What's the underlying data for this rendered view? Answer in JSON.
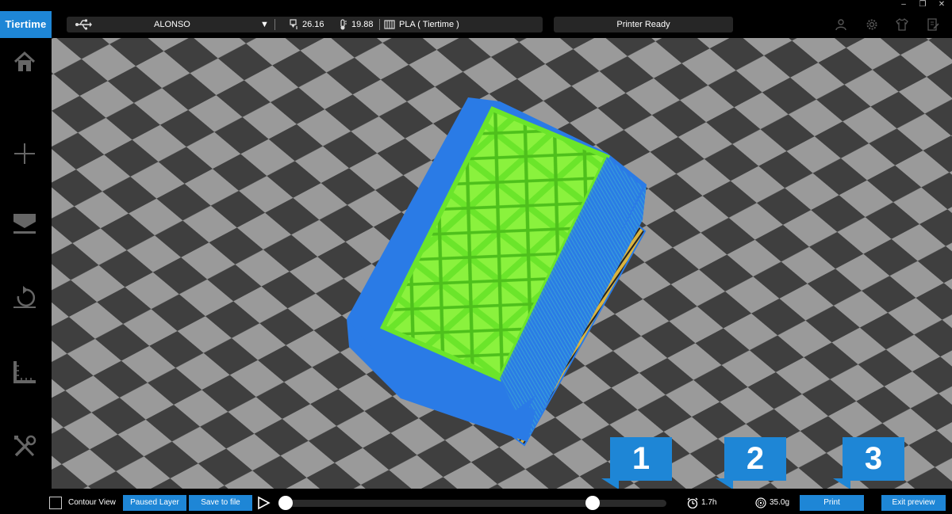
{
  "app": {
    "logo": "Tiertime"
  },
  "topbar": {
    "printer_name": "ALONSO",
    "dropdown_glyph": "▼",
    "nozzle_temp": "26.16",
    "bed_temp": "19.88",
    "material": "PLA ( Tiertime )",
    "status": "Printer Ready"
  },
  "sidebar": {
    "items": [
      {
        "icon": "home-icon"
      },
      {
        "icon": "add-icon"
      },
      {
        "icon": "print-icon"
      },
      {
        "icon": "rotate-icon"
      },
      {
        "icon": "ruler-icon"
      },
      {
        "icon": "tools-icon"
      }
    ]
  },
  "bottombar": {
    "contour_view_label": "Contour View",
    "contour_view_checked": false,
    "paused_layer_label": "Paused Layer",
    "save_to_file_label": "Save to file",
    "print_time": "1.7h",
    "weight": "35.0g",
    "print_label": "Print",
    "exit_preview_label": "Exit preview"
  },
  "callouts": [
    "1",
    "2",
    "3"
  ],
  "colors": {
    "accent": "#1e86d6",
    "model_outer": "#2a7be6",
    "model_infill": "#66ee22",
    "raft": "#d9b441"
  }
}
